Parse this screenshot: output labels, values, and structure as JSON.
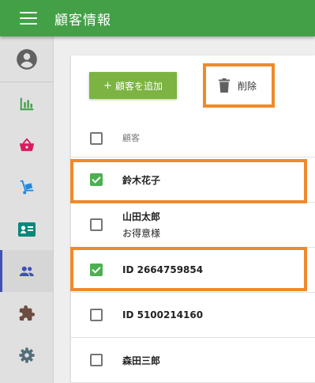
{
  "app": {
    "title": "顧客情報"
  },
  "sidebar": {
    "items": [
      {
        "name": "account",
        "icon": "account-circle-icon",
        "color": "#616161"
      },
      {
        "name": "dashboard",
        "icon": "bar-chart-icon",
        "color": "#43a047"
      },
      {
        "name": "orders",
        "icon": "shopping-basket-icon",
        "color": "#d81b60"
      },
      {
        "name": "products",
        "icon": "hand-truck-icon",
        "color": "#1e88e5"
      },
      {
        "name": "info",
        "icon": "id-card-icon",
        "color": "#00897b"
      },
      {
        "name": "customers",
        "icon": "people-icon",
        "color": "#3f51b5",
        "active": true
      },
      {
        "name": "extensions",
        "icon": "puzzle-icon",
        "color": "#6d4c41"
      },
      {
        "name": "settings",
        "icon": "gear-icon",
        "color": "#546e7a"
      }
    ]
  },
  "toolbar": {
    "add_label": "顧客を追加",
    "add_icon": "+",
    "delete_label": "削除",
    "delete_icon": "trash-icon"
  },
  "table": {
    "header": "顧客",
    "rows": [
      {
        "name": "鈴木花子",
        "sub": "",
        "checked": true
      },
      {
        "name": "山田太郎",
        "sub": "お得意様",
        "checked": false
      },
      {
        "name": "ID 2664759854",
        "sub": "",
        "checked": true
      },
      {
        "name": "ID 5100214160",
        "sub": "",
        "checked": false
      },
      {
        "name": "森田三郎",
        "sub": "",
        "checked": false
      }
    ]
  },
  "colors": {
    "appbar": "#43a047",
    "add_button": "#7cb342",
    "checkbox_checked": "#4caf50",
    "highlight": "#ef8a2b",
    "active_indicator": "#3f51b5"
  }
}
